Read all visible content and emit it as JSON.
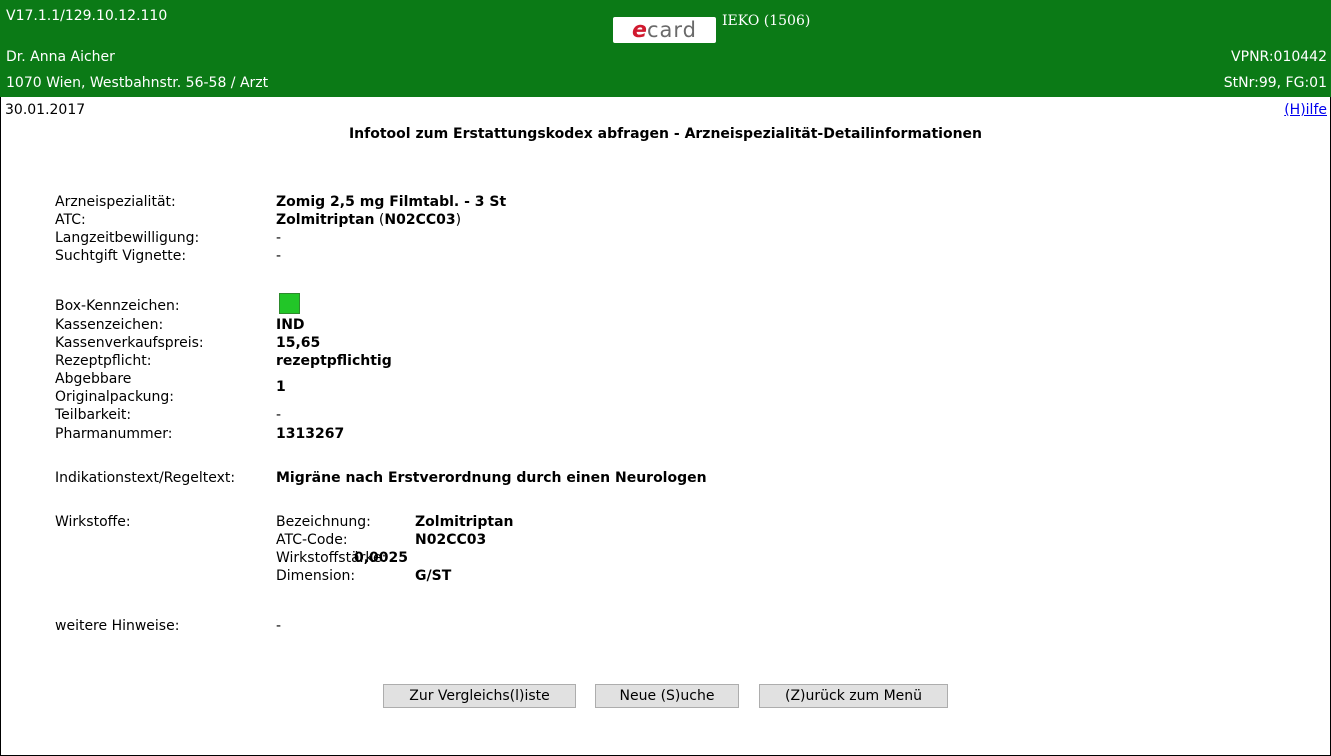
{
  "header": {
    "version": "V17.1.1/129.10.12.110",
    "logo": {
      "e": "e",
      "rest": "card"
    },
    "ieko": "IEKO (1506)",
    "doctor": "Dr. Anna Aicher",
    "vpnr": "VPNR:010442",
    "address": "1070 Wien, Westbahnstr. 56-58 / Arzt",
    "stnr": "StNr:99, FG:01",
    "color": "#0b7a16"
  },
  "date": "30.01.2017",
  "help_link": "(H)ilfe",
  "title": "Infotool zum Erstattungskodex abfragen - Arzneispezialität-Detailinformationen",
  "fields": {
    "arzneispezialitaet": {
      "label": "Arzneispezialität:",
      "value": "Zomig 2,5 mg Filmtabl. - 3 St"
    },
    "atc": {
      "label": "ATC:",
      "value_name": "Zolmitriptan",
      "value_code": "N02CC03"
    },
    "langzeit": {
      "label": "Langzeitbewilligung:",
      "value": "-"
    },
    "suchtgift": {
      "label": "Suchtgift Vignette:",
      "value": "-"
    },
    "box": {
      "label": "Box-Kennzeichen:",
      "color": "#22c628"
    },
    "kassenzeichen": {
      "label": "Kassenzeichen:",
      "value": "IND"
    },
    "kassenverkaufspreis": {
      "label": "Kassenverkaufspreis:",
      "value": "15,65"
    },
    "rezeptpflicht": {
      "label": "Rezeptpflicht:",
      "value": "rezeptpflichtig"
    },
    "originalpackung": {
      "label_1": "Abgebbare",
      "label_2": "Originalpackung:",
      "value": "1"
    },
    "teilbarkeit": {
      "label": "Teilbarkeit:",
      "value": "-"
    },
    "pharmanummer": {
      "label": "Pharmanummer:",
      "value": "1313267"
    },
    "indikation": {
      "label": "Indikationstext/Regeltext:",
      "value": "Migräne nach Erstverordnung durch einen Neurologen"
    },
    "wirkstoffe": {
      "label": "Wirkstoffe:",
      "bezeichnung_label": "Bezeichnung:",
      "bezeichnung": "Zolmitriptan",
      "atc_code_label": "ATC-Code:",
      "atc_code": "N02CC03",
      "staerke_label": "Wirkstoffstärke:",
      "staerke": "0,0025",
      "dimension_label": "Dimension:",
      "dimension": "G/ST"
    },
    "hinweise": {
      "label": "weitere Hinweise:",
      "value": "-"
    }
  },
  "buttons": {
    "compare": "Zur Vergleichs(l)iste",
    "new_search": "Neue (S)uche",
    "back": "(Z)urück zum Menü"
  }
}
